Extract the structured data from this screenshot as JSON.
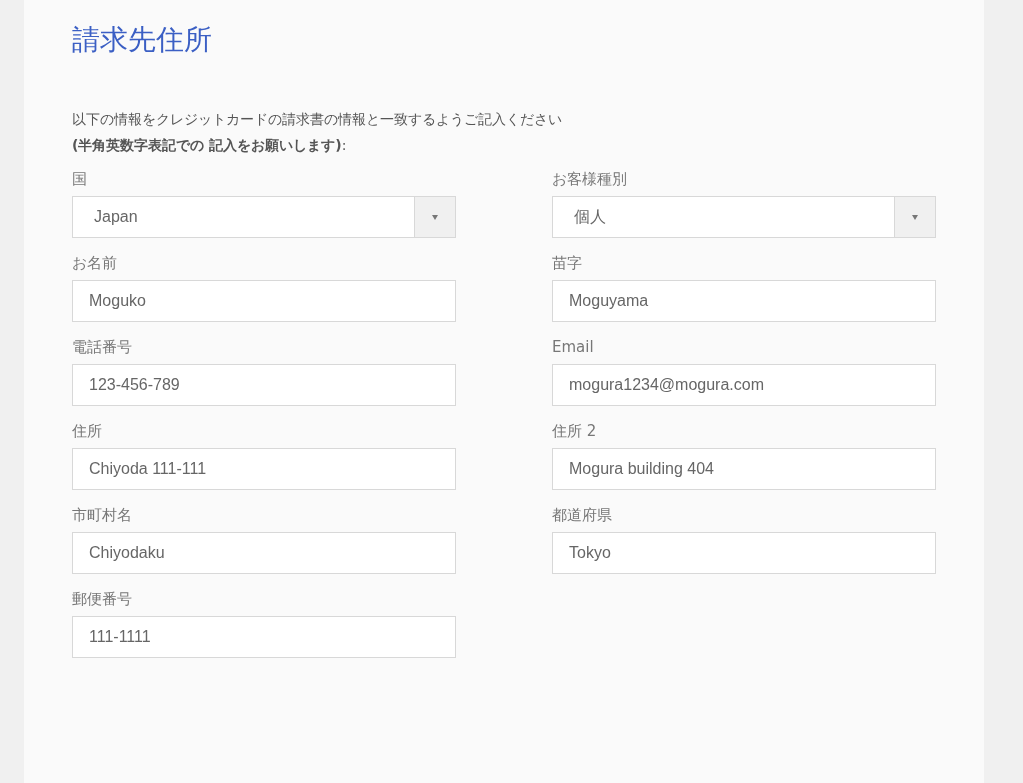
{
  "title": "請求先住所",
  "intro": "以下の情報をクレジットカードの請求書の情報と一致するようご記入ください",
  "note": "**(半角英数字表記での 記入をお願いします)**:",
  "fields": [
    {
      "label": "国",
      "kind": "select",
      "value": "Japan"
    },
    {
      "label": "お客様種別",
      "kind": "select",
      "value": "個人"
    },
    {
      "label": "お名前",
      "kind": "text",
      "value": "Moguko"
    },
    {
      "label": "苗字",
      "kind": "text",
      "value": "Moguyama"
    },
    {
      "label": "電話番号",
      "kind": "text",
      "value": "123-456-789"
    },
    {
      "label": "Email",
      "kind": "text",
      "value": "mogura1234@mogura.com"
    },
    {
      "label": "住所",
      "kind": "text",
      "value": "Chiyoda 111-111"
    },
    {
      "label": "住所 2",
      "kind": "text",
      "value": "Mogura building 404"
    },
    {
      "label": "市町村名",
      "kind": "text",
      "value": "Chiyodaku"
    },
    {
      "label": "都道府県",
      "kind": "text",
      "value": "Tokyo"
    },
    {
      "label": "郵便番号",
      "kind": "text",
      "value": "111-1111"
    }
  ]
}
